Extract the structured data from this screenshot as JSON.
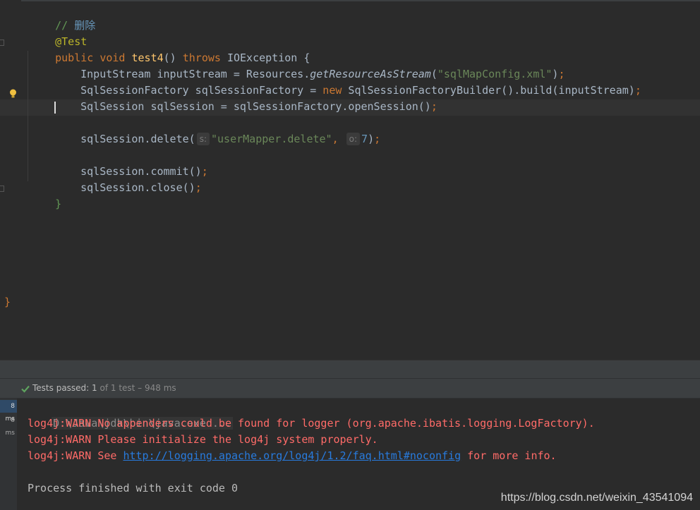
{
  "editor": {
    "comment_slashes": "// ",
    "comment_text": "删除",
    "annotation": "@Test",
    "method_kw_public": "public",
    "method_kw_void": "void",
    "method_name": "test4",
    "method_parens": "()",
    "throws_kw": "throws",
    "exception": "IOException",
    "open_brace": "{",
    "line_input_decl": "InputStream inputStream = Resources.",
    "line_input_call": "getResourceAsStream",
    "line_input_arg": "\"sqlMapConfig.xml\"",
    "line_factory_decl": "SqlSessionFactory sqlSessionFactory = ",
    "new_kw": "new",
    "line_factory_rest": " SqlSessionFactoryBuilder().build(inputStream)",
    "line_session": "SqlSession sqlSession = sqlSessionFactory.openSession()",
    "line_delete_call": "sqlSession.delete(",
    "hint_s": "s:",
    "delete_arg_str": "\"userMapper.delete\"",
    "hint_o": "o:",
    "delete_arg_num": "7",
    "line_commit": "sqlSession.commit()",
    "line_close": "sqlSession.close()",
    "close_brace": "}",
    "outer_brace": "}"
  },
  "status": {
    "passed_label": "Tests passed: ",
    "passed_count": "1",
    "of_total": " of 1 test – 948 ms"
  },
  "console": {
    "time_tags": [
      "8 ms",
      "8 ms"
    ],
    "command": "D:\\Java\\jdk\\bin\\java.exe ...",
    "warn1": "log4j:WARN No appenders could be found for logger (org.apache.ibatis.logging.LogFactory).",
    "warn2": "log4j:WARN Please initialize the log4j system properly.",
    "warn3_prefix": "log4j:WARN See ",
    "warn3_link": "http://logging.apache.org/log4j/1.2/faq.html#noconfig",
    "warn3_suffix": " for more info.",
    "finished": "Process finished with exit code 0"
  },
  "watermark": "https://blog.csdn.net/weixin_43541094"
}
